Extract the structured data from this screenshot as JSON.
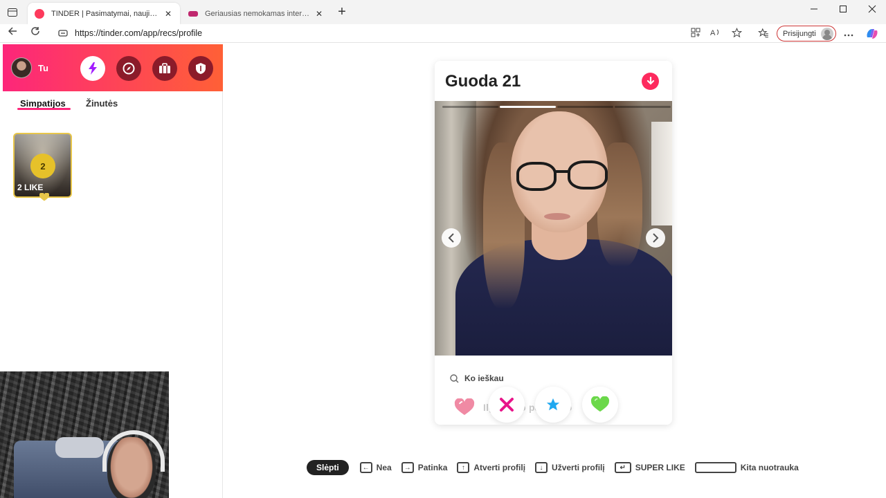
{
  "browser": {
    "tabs": [
      {
        "title": "TINDER | Pasimatymai, nauji draugai",
        "active": true,
        "favicon_color": "#fd3a5c"
      },
      {
        "title": "Geriausias nemokamas internetinis",
        "active": false,
        "favicon_color": "#c0286e"
      }
    ],
    "url": "https://tinder.com/app/recs/profile",
    "login_label": "Prisijungti",
    "close_tab_glyph": "✕",
    "new_tab_glyph": "+"
  },
  "sidebar": {
    "user_name": "Tu",
    "tabs": [
      "Simpatijos",
      "Žinutės"
    ],
    "active_tab": "Simpatijos",
    "likes_count": "2",
    "likes_label": "2 LIKE"
  },
  "profile": {
    "name_age": "Guoda 21",
    "photo_count": 4,
    "current_photo": 2,
    "search_label": "Ko ieškau",
    "looking_for": "Ilgalaikio partnerio"
  },
  "hints": {
    "hide": "Slėpti",
    "items": [
      {
        "key": "←",
        "label": "Nea"
      },
      {
        "key": "→",
        "label": "Patinka"
      },
      {
        "key": "↑",
        "label": "Atverti profilį"
      },
      {
        "key": "↓",
        "label": "Užverti profilį"
      },
      {
        "key": "↵",
        "label": "SUPER LIKE"
      },
      {
        "key": " ",
        "label": "Kita nuotrauka"
      }
    ]
  },
  "colors": {
    "brand_start": "#fd267a",
    "brand_end": "#ff6036",
    "like_green": "#6bd84a",
    "nope_pink": "#e8158a",
    "superlike_blue": "#1fa8f0"
  }
}
